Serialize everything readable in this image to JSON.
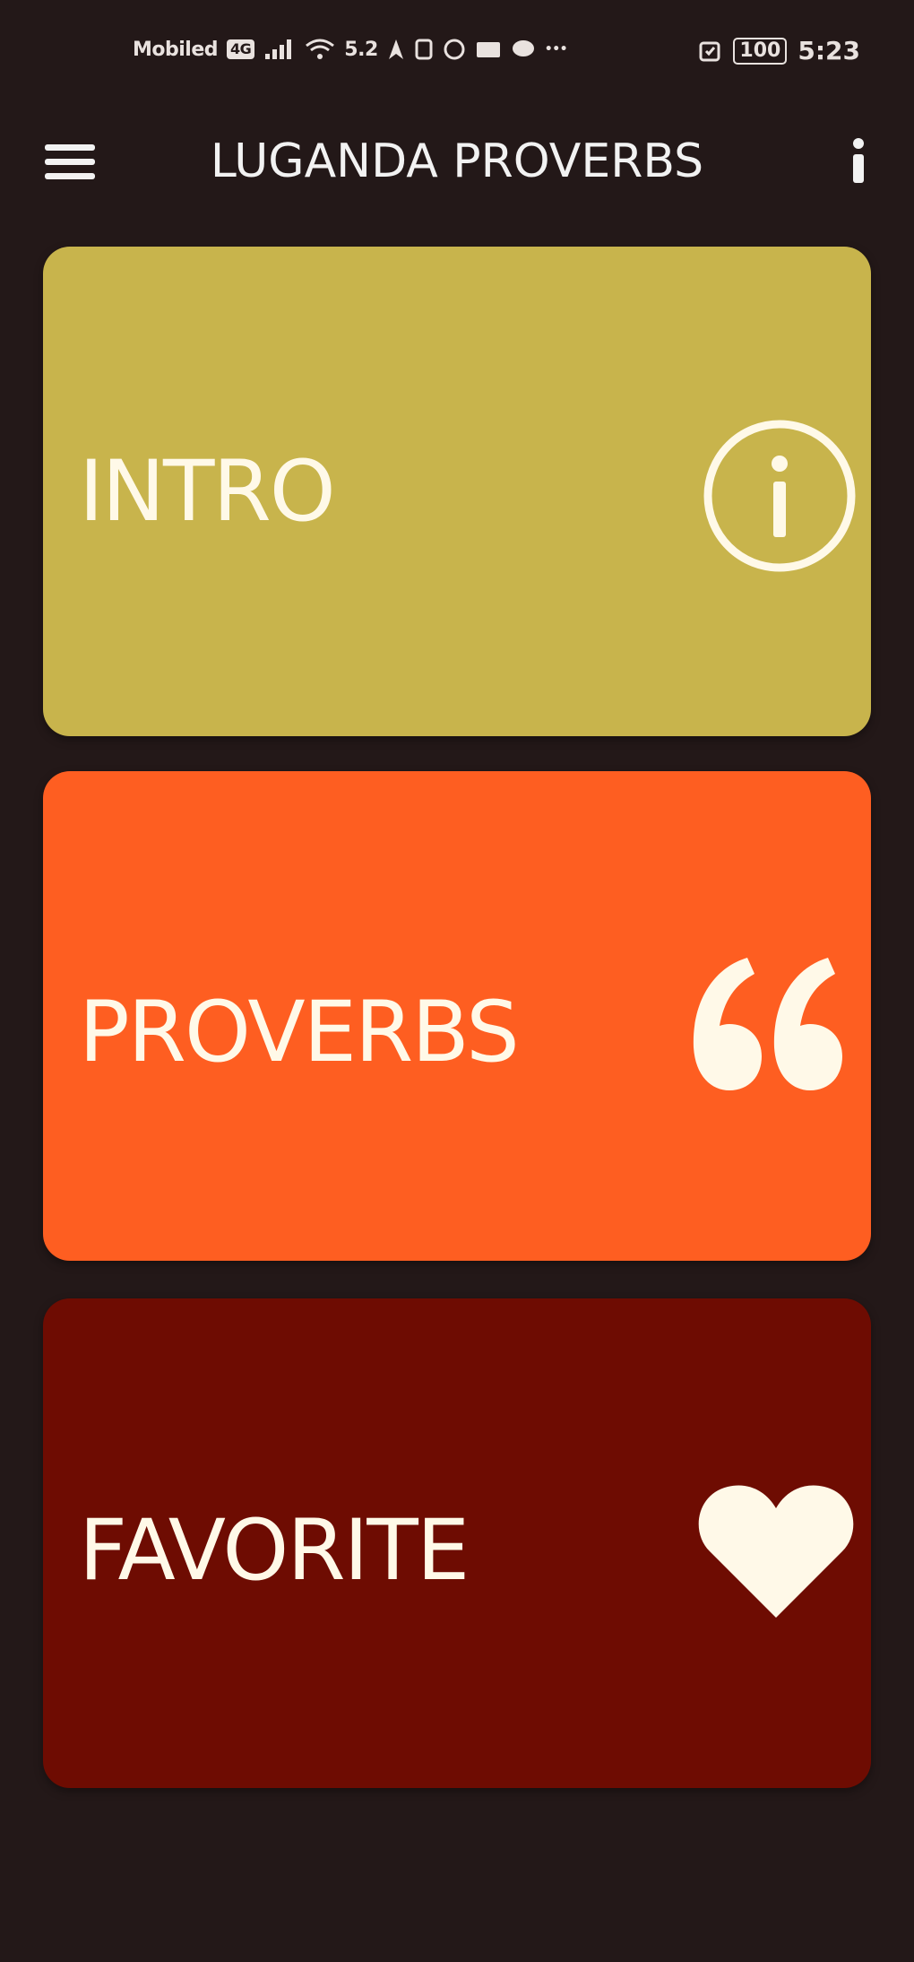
{
  "status_bar": {
    "carrier": "Mobiled",
    "network_tag": "4G",
    "speed": "5.2",
    "battery": "100",
    "time": "5:23"
  },
  "app_bar": {
    "title": "LUGANDA PROVERBS",
    "menu_icon": "hamburger-menu-icon",
    "info_icon": "info-vertical-icon"
  },
  "cards": [
    {
      "label": "INTRO",
      "icon": "info-circle-icon",
      "color": "#c8b44c"
    },
    {
      "label": "PROVERBS",
      "icon": "quote-icon",
      "color": "#fe5e21"
    },
    {
      "label": "FAVORITE",
      "icon": "heart-icon",
      "color": "#6e0c02"
    }
  ],
  "colors": {
    "background": "#231818",
    "text": "#fff9e8"
  }
}
